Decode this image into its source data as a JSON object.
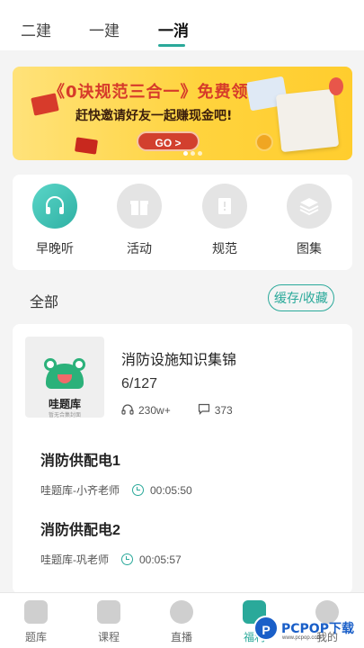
{
  "tabs": [
    {
      "label": "二建"
    },
    {
      "label": "一建"
    },
    {
      "label": "一消"
    }
  ],
  "banner": {
    "title": "《0诀规范三合一》免费领",
    "subtitle": "赶快邀请好友一起赚现金吧!",
    "go_label": "GO >"
  },
  "quick": [
    {
      "label": "早晚听",
      "icon": "headphones-icon"
    },
    {
      "label": "活动",
      "icon": "gift-icon"
    },
    {
      "label": "规范",
      "icon": "book-icon"
    },
    {
      "label": "图集",
      "icon": "layers-icon"
    }
  ],
  "section": {
    "title": "全部",
    "cache_button": "缓存/收藏"
  },
  "course": {
    "cover_title": "哇题库",
    "cover_sub": "暂无合集封面",
    "title": "消防设施知识集锦",
    "progress": "6/127",
    "listens": "230w+",
    "comments": "373"
  },
  "lessons": [
    {
      "title": "消防供配电1",
      "teacher": "哇题库-小齐老师",
      "duration": "00:05:50"
    },
    {
      "title": "消防供配电2",
      "teacher": "哇题库-巩老师",
      "duration": "00:05:57"
    }
  ],
  "nav": [
    {
      "label": "题库",
      "icon": "pencil-icon"
    },
    {
      "label": "课程",
      "icon": "video-icon"
    },
    {
      "label": "直播",
      "icon": "live-icon"
    },
    {
      "label": "福利",
      "icon": "gift-nav-icon"
    },
    {
      "label": "我的",
      "icon": "user-icon"
    }
  ],
  "watermark": {
    "logo": "P",
    "text": "PCPOP下载",
    "small": "www.pcpop.com"
  },
  "colors": {
    "accent": "#2aa99a",
    "banner": "#ffd33d",
    "banner_title": "#d63a2a"
  }
}
